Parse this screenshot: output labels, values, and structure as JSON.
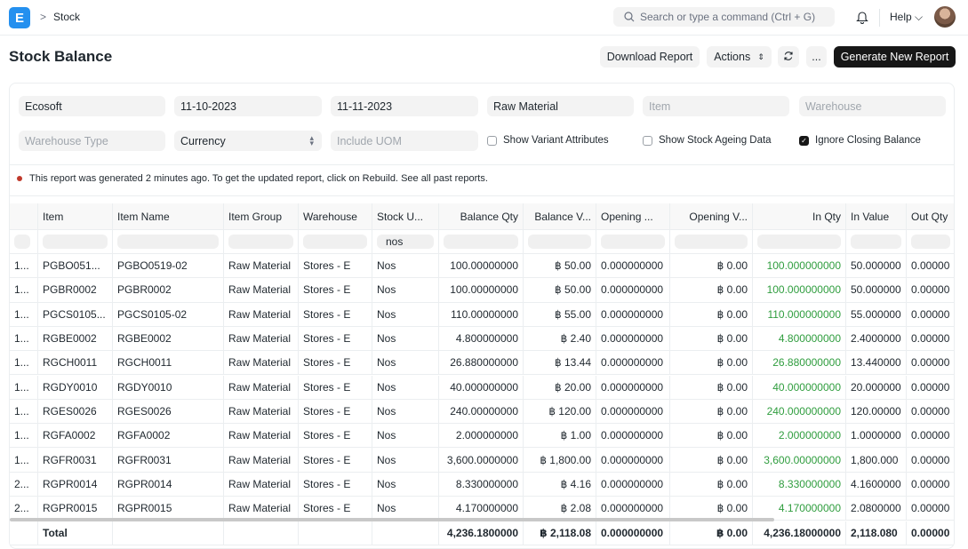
{
  "nav": {
    "breadcrumb": "Stock",
    "search_placeholder": "Search or type a command (Ctrl + G)",
    "help": "Help"
  },
  "page": {
    "title": "Stock Balance",
    "download": "Download Report",
    "actions": "Actions",
    "more": "...",
    "generate": "Generate New Report"
  },
  "filters": {
    "company": "Ecosoft",
    "from_date": "11-10-2023",
    "to_date": "11-11-2023",
    "item_group": "Raw Material",
    "item_ph": "Item",
    "warehouse_ph": "Warehouse",
    "warehouse_type_ph": "Warehouse Type",
    "currency": "Currency",
    "include_uom_ph": "Include UOM",
    "show_variant": "Show Variant Attributes",
    "show_ageing": "Show Stock Ageing Data",
    "ignore_closing": "Ignore Closing Balance"
  },
  "notice": {
    "text": "This report was generated 2 minutes ago. To get the updated report, click on Rebuild.",
    "link": "See all past reports."
  },
  "table": {
    "headers": [
      "Item",
      "Item Name",
      "Item Group",
      "Warehouse",
      "Stock U...",
      "Balance Qty",
      "Balance V...",
      "Opening ...",
      "Opening V...",
      "In Qty",
      "In Value",
      "Out Qty"
    ],
    "uom_filter": "nos",
    "rows": [
      [
        "1...",
        "PGBO051...",
        "PGBO0519-02",
        "Raw Material",
        "Stores - E",
        "Nos",
        "100.00000000",
        "฿ 50.00",
        "0.000000000",
        "฿ 0.00",
        "100.000000000",
        "50.000000",
        "0.00000"
      ],
      [
        "1...",
        "PGBR0002",
        "PGBR0002",
        "Raw Material",
        "Stores - E",
        "Nos",
        "100.00000000",
        "฿ 50.00",
        "0.000000000",
        "฿ 0.00",
        "100.000000000",
        "50.000000",
        "0.00000"
      ],
      [
        "1...",
        "PGCS0105...",
        "PGCS0105-02",
        "Raw Material",
        "Stores - E",
        "Nos",
        "110.00000000",
        "฿ 55.00",
        "0.000000000",
        "฿ 0.00",
        "110.000000000",
        "55.000000",
        "0.00000"
      ],
      [
        "1...",
        "RGBE0002",
        "RGBE0002",
        "Raw Material",
        "Stores - E",
        "Nos",
        "4.800000000",
        "฿ 2.40",
        "0.000000000",
        "฿ 0.00",
        "4.800000000",
        "2.4000000",
        "0.00000"
      ],
      [
        "1...",
        "RGCH0011",
        "RGCH0011",
        "Raw Material",
        "Stores - E",
        "Nos",
        "26.880000000",
        "฿ 13.44",
        "0.000000000",
        "฿ 0.00",
        "26.880000000",
        "13.440000",
        "0.00000"
      ],
      [
        "1...",
        "RGDY0010",
        "RGDY0010",
        "Raw Material",
        "Stores - E",
        "Nos",
        "40.000000000",
        "฿ 20.00",
        "0.000000000",
        "฿ 0.00",
        "40.000000000",
        "20.000000",
        "0.00000"
      ],
      [
        "1...",
        "RGES0026",
        "RGES0026",
        "Raw Material",
        "Stores - E",
        "Nos",
        "240.00000000",
        "฿ 120.00",
        "0.000000000",
        "฿ 0.00",
        "240.000000000",
        "120.00000",
        "0.00000"
      ],
      [
        "1...",
        "RGFA0002",
        "RGFA0002",
        "Raw Material",
        "Stores - E",
        "Nos",
        "2.000000000",
        "฿ 1.00",
        "0.000000000",
        "฿ 0.00",
        "2.000000000",
        "1.0000000",
        "0.00000"
      ],
      [
        "1...",
        "RGFR0031",
        "RGFR0031",
        "Raw Material",
        "Stores - E",
        "Nos",
        "3,600.0000000",
        "฿ 1,800.00",
        "0.000000000",
        "฿ 0.00",
        "3,600.00000000",
        "1,800.000",
        "0.00000"
      ],
      [
        "2...",
        "RGPR0014",
        "RGPR0014",
        "Raw Material",
        "Stores - E",
        "Nos",
        "8.330000000",
        "฿ 4.16",
        "0.000000000",
        "฿ 0.00",
        "8.330000000",
        "4.1600000",
        "0.00000"
      ],
      [
        "2...",
        "RGPR0015",
        "RGPR0015",
        "Raw Material",
        "Stores - E",
        "Nos",
        "4.170000000",
        "฿ 2.08",
        "0.000000000",
        "฿ 0.00",
        "4.170000000",
        "2.0800000",
        "0.00000"
      ]
    ],
    "total": [
      "",
      "Total",
      "",
      "",
      "",
      "",
      "4,236.1800000",
      "฿ 2,118.08",
      "0.000000000",
      "฿ 0.00",
      "4,236.18000000",
      "2,118.080",
      "0.00000"
    ]
  }
}
